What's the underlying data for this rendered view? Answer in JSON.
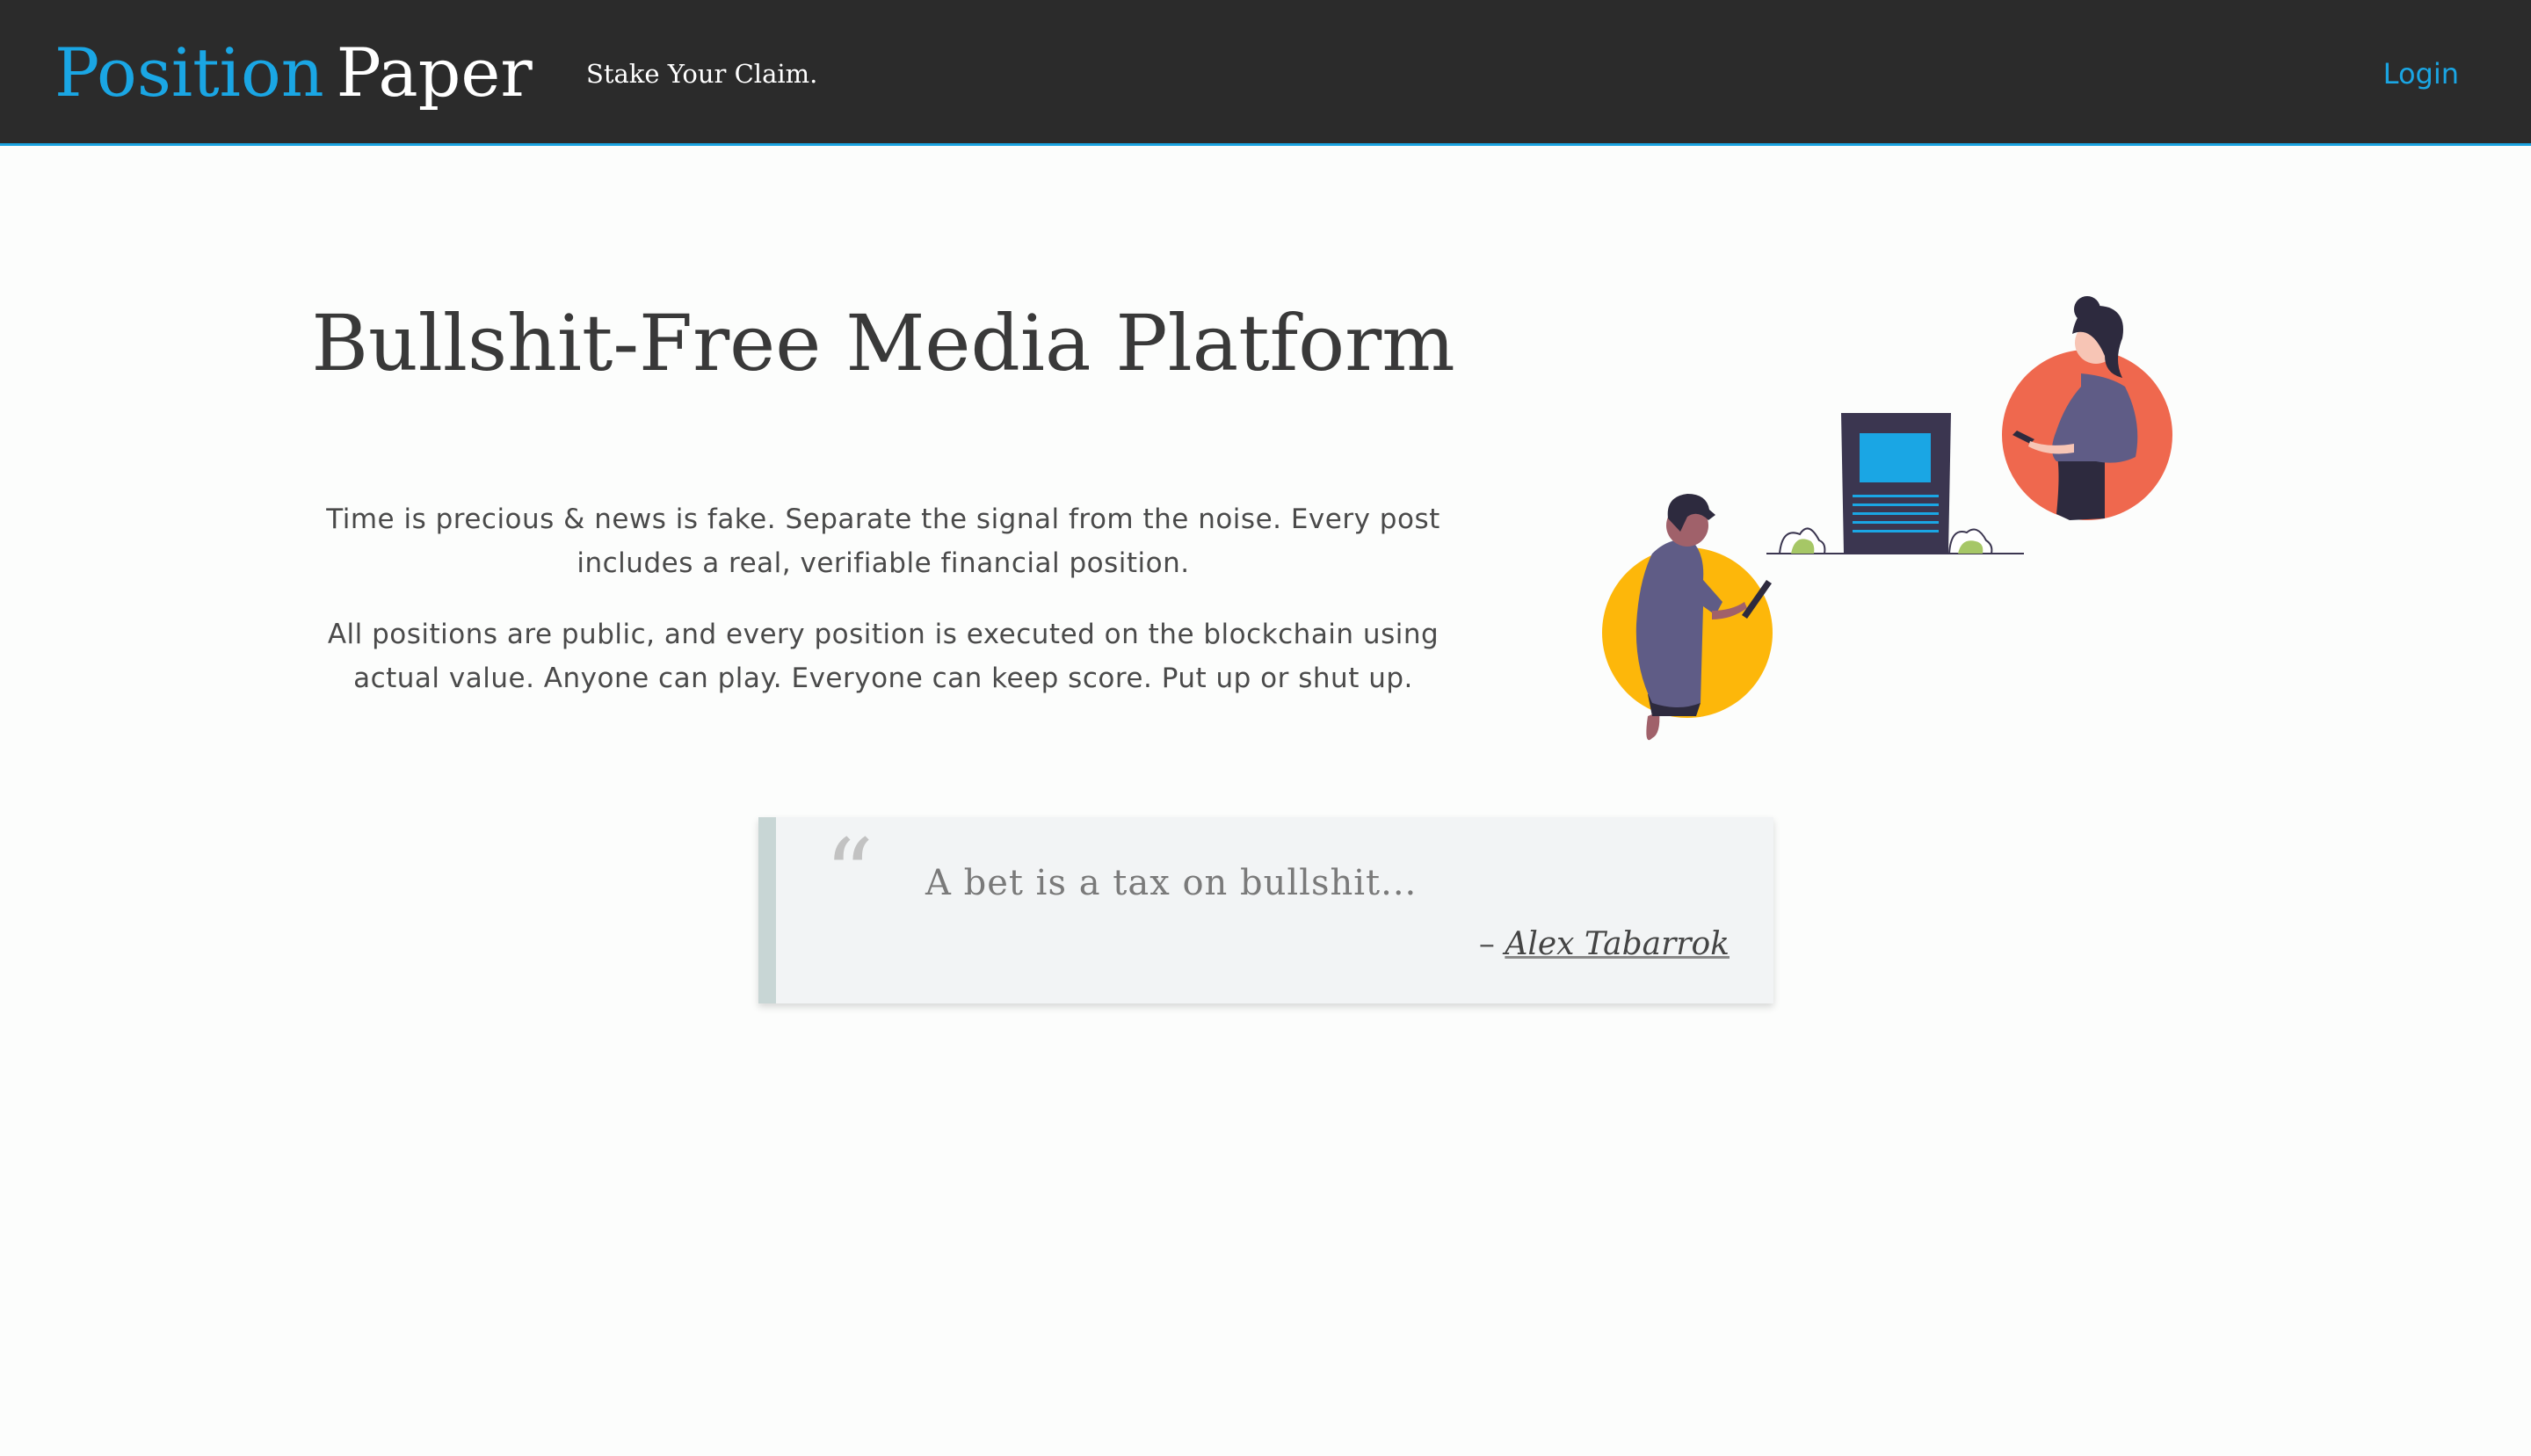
{
  "header": {
    "brand_part1": "Position",
    "brand_part2": "Paper",
    "tagline": "Stake Your Claim.",
    "login_label": "Login"
  },
  "hero": {
    "title": "Bullshit-Free Media Platform",
    "paragraph1": "Time is precious & news is fake. Separate the signal from the noise. Every post includes a real, verifiable financial position.",
    "paragraph2": "All positions are public, and every position is executed on the blockchain using actual value. Anyone can play. Everyone can keep score. Put up or shut up."
  },
  "quote": {
    "mark": "“",
    "text": "A bet is a tax on bullshit...",
    "dash": "–",
    "author": "Alex Tabarrok"
  },
  "colors": {
    "header_bg": "#2b2b2b",
    "accent_blue": "#1aa6e4",
    "page_bg": "#fcfdfc",
    "circle_orange": "#ef684e",
    "circle_yellow": "#fdb70a",
    "figure_purple": "#5f5c86",
    "dark_navy": "#3b3650"
  },
  "icons": {
    "illustration": "people-with-phones-and-news-board-illustration"
  }
}
